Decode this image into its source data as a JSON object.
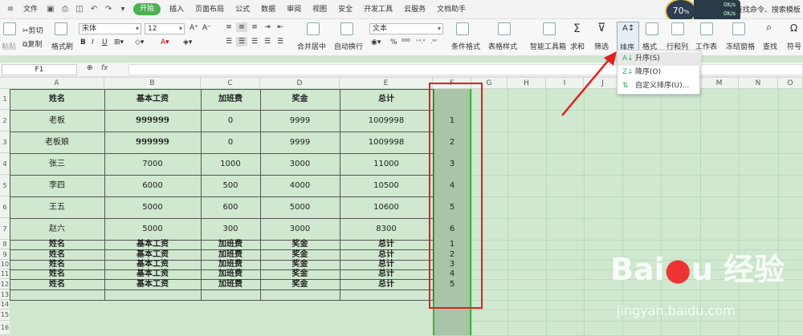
{
  "menubar": {
    "file": "文件",
    "tabs": [
      "开始",
      "插入",
      "页面布局",
      "公式",
      "数据",
      "审阅",
      "视图",
      "安全",
      "开发工具",
      "云服务",
      "文档助手"
    ],
    "active_tab": "开始",
    "search": "查找命令、搜索模板"
  },
  "speed": {
    "percent": "70",
    "unit": "%",
    "up": "0K/s",
    "down": "0K/s"
  },
  "toolbar": {
    "paste": "粘贴",
    "cut": "剪切",
    "copy": "复制",
    "format_painter": "格式刷",
    "font_name": "宋体",
    "font_size": "12",
    "merge": "合并居中",
    "wrap": "自动换行",
    "number_format": "文本",
    "cond_format": "条件格式",
    "table_style": "表格样式",
    "smart_tools": "智能工具箱",
    "sum": "求和",
    "filter": "筛选",
    "sort": "排序",
    "format": "格式",
    "row_col": "行和列",
    "worksheet": "工作表",
    "freeze": "冻结窗格",
    "find": "查找",
    "symbol": "符号"
  },
  "sort_menu": {
    "ascending": "升序(S)",
    "descending": "降序(O)",
    "custom": "自定义排序(U)..."
  },
  "formula_bar": {
    "name_box": "F1",
    "fx": "fx"
  },
  "columns": [
    "A",
    "B",
    "C",
    "D",
    "E",
    "F",
    "G",
    "H",
    "I",
    "J",
    "K",
    "L",
    "M",
    "N",
    "O"
  ],
  "rows": [
    "1",
    "2",
    "3",
    "4",
    "5",
    "6",
    "7",
    "8",
    "9",
    "10",
    "11",
    "12",
    "13",
    "14",
    "15",
    "16"
  ],
  "table": {
    "headers": [
      "姓名",
      "基本工资",
      "加班费",
      "奖金",
      "总计"
    ],
    "data": [
      [
        "老板",
        "999999",
        "0",
        "9999",
        "1009998",
        "1"
      ],
      [
        "老板娘",
        "999999",
        "0",
        "9999",
        "1009998",
        "2"
      ],
      [
        "张三",
        "7000",
        "1000",
        "3000",
        "11000",
        "3"
      ],
      [
        "李四",
        "6000",
        "500",
        "4000",
        "10500",
        "4"
      ],
      [
        "王五",
        "5000",
        "600",
        "5000",
        "10600",
        "5"
      ],
      [
        "赵六",
        "5000",
        "300",
        "3000",
        "8300",
        "6"
      ]
    ],
    "repeat_rows": [
      [
        "姓名",
        "基本工资",
        "加班费",
        "奖金",
        "总计",
        "1"
      ],
      [
        "姓名",
        "基本工资",
        "加班费",
        "奖金",
        "总计",
        "2"
      ],
      [
        "姓名",
        "基本工资",
        "加班费",
        "奖金",
        "总计",
        "3"
      ],
      [
        "姓名",
        "基本工资",
        "加班费",
        "奖金",
        "总计",
        "4"
      ],
      [
        "姓名",
        "基本工资",
        "加班费",
        "奖金",
        "总计",
        "5"
      ]
    ]
  },
  "watermark": {
    "logo": "Bai 经验",
    "url": "jingyan.baidu.com"
  },
  "colors": {
    "accent": "#4caf50",
    "selection": "#3ab03a",
    "highlight": "#e02020",
    "sheet_bg": "#cfe8cf"
  }
}
